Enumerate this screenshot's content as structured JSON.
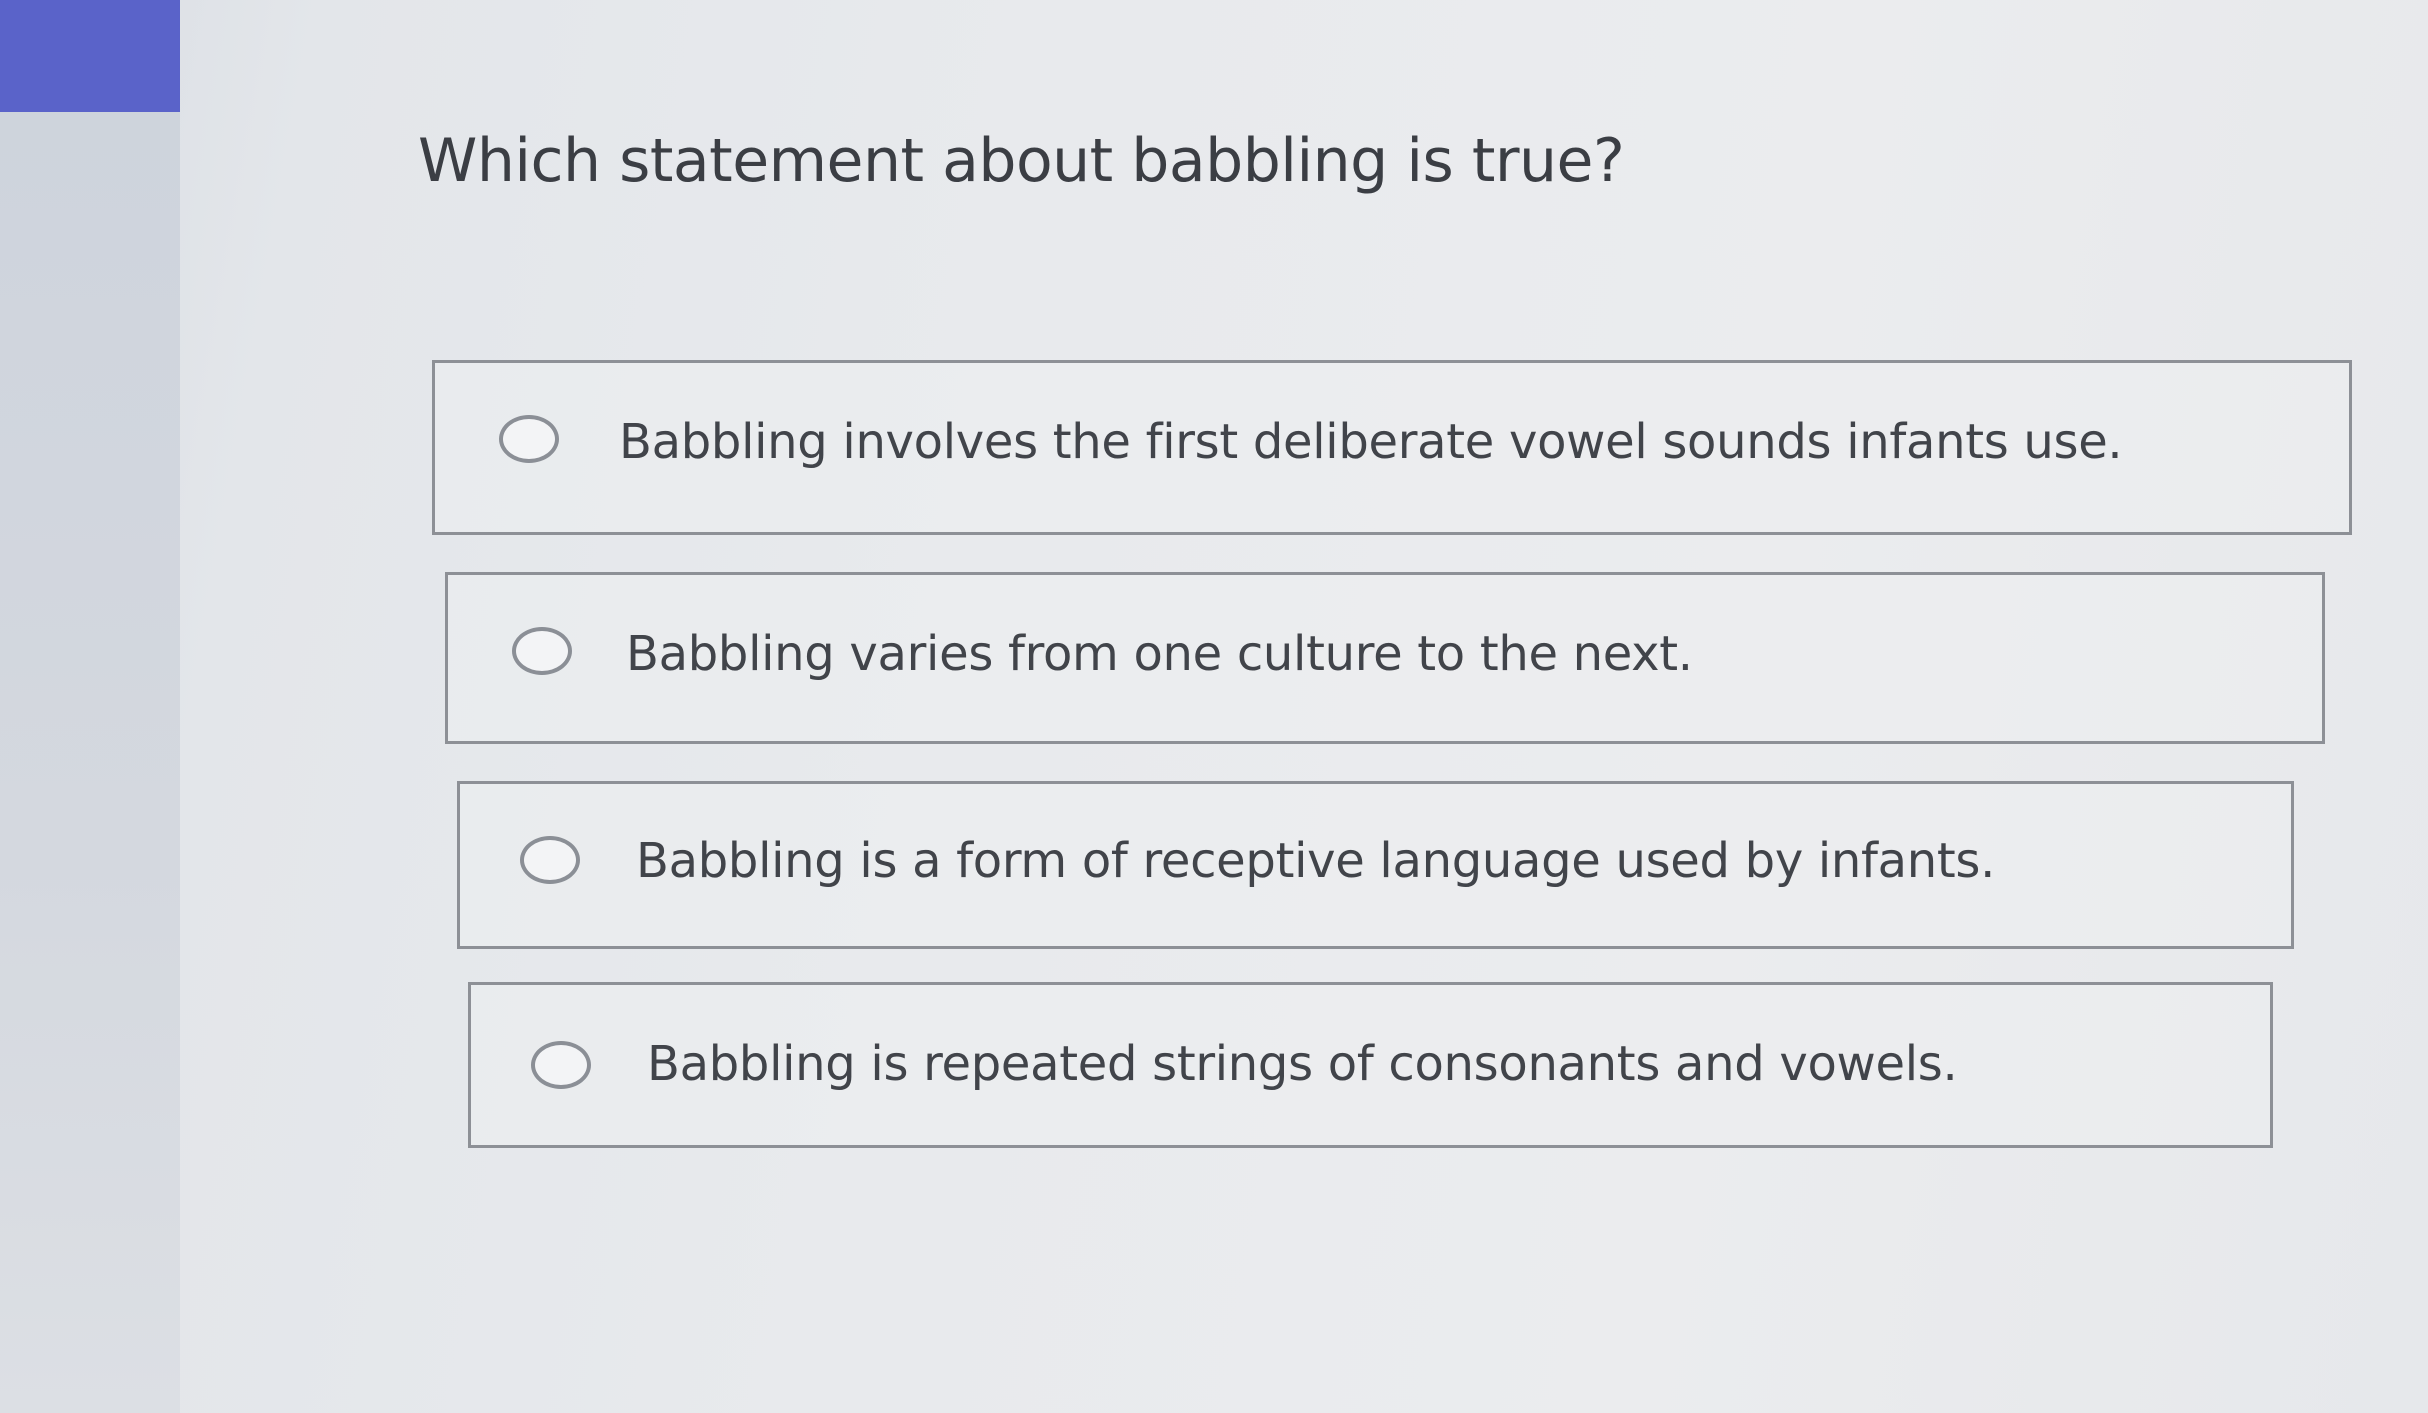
{
  "theme": {
    "accent": "#5a63c9",
    "border": "#8d9096",
    "text": "#3b3e44"
  },
  "question": {
    "text": "Which statement about babbling is true?"
  },
  "options": [
    {
      "label": "Babbling involves the first deliberate vowel sounds infants use.",
      "selected": false
    },
    {
      "label": "Babbling varies from one culture to the next.",
      "selected": false
    },
    {
      "label": "Babbling is a form of receptive language used by infants.",
      "selected": false
    },
    {
      "label": "Babbling is repeated strings of consonants and vowels.",
      "selected": false
    }
  ]
}
